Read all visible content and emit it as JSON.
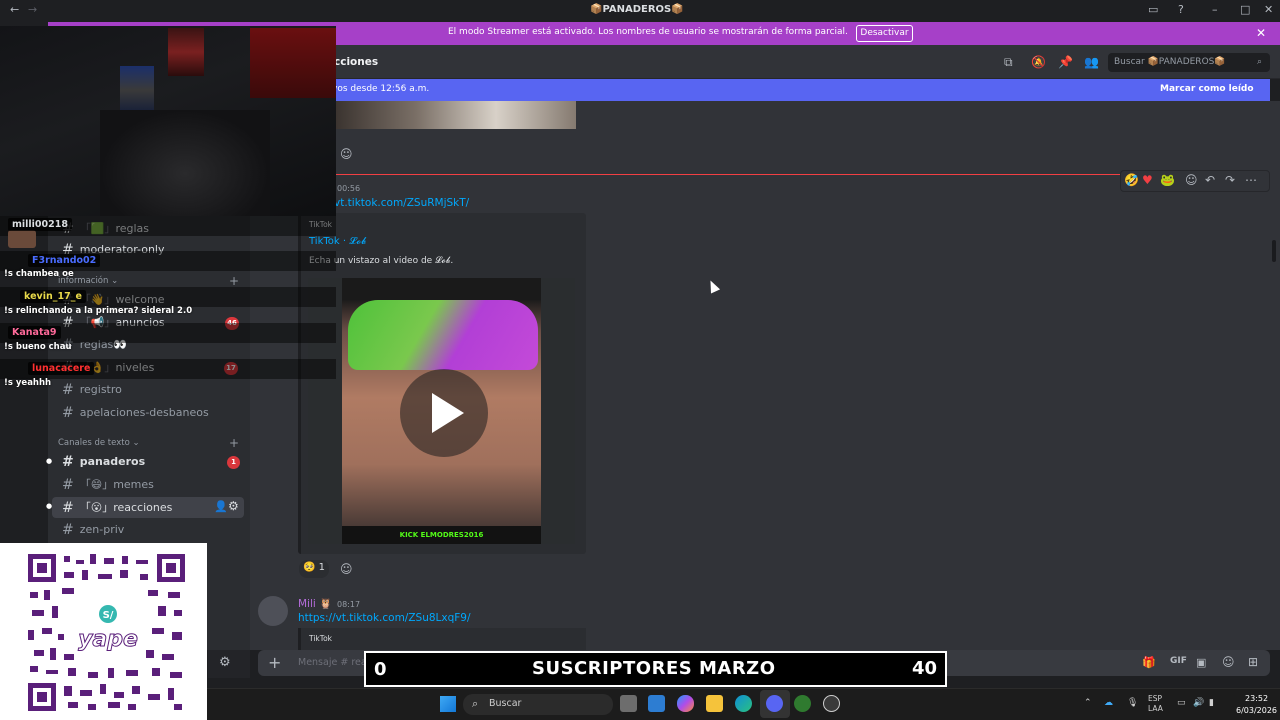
{
  "titlebar": {
    "title": "📦PANADEROS📦"
  },
  "streamer_banner": {
    "text": "El modo Streamer está activado. Los nombres de usuario se mostrarán de forma parcial.",
    "button": "Desactivar"
  },
  "header": {
    "channel": "cciones",
    "search_placeholder": "Buscar 📦PANADEROS📦"
  },
  "new_messages": {
    "text": "vos desde 12:56 a.m.",
    "action": "Marcar como leído"
  },
  "sidebar": {
    "channels_top": [
      {
        "label": "reglas",
        "badge": ""
      },
      {
        "label": "moderator-only",
        "badge": ""
      }
    ],
    "category_info": "información",
    "channels_info": [
      {
        "label": "welcome",
        "badge": ""
      },
      {
        "label": "anuncios",
        "badge": "46"
      },
      {
        "label": "reglas👀",
        "badge": ""
      },
      {
        "label": "niveles",
        "badge": "17"
      },
      {
        "label": "registro",
        "badge": ""
      },
      {
        "label": "apelaciones-desbaneos",
        "badge": ""
      }
    ],
    "category_text": "Canales de texto",
    "channels_text": [
      {
        "label": "panaderos",
        "badge": "1"
      },
      {
        "label": "memes",
        "badge": ""
      },
      {
        "label": "reacciones",
        "badge": ""
      },
      {
        "label": "zen-priv",
        "badge": ""
      }
    ]
  },
  "messages": {
    "first": {
      "time": "00:56",
      "link": "vt.tiktok.com/ZSuRMjSkT/",
      "embed_provider": "TikTok",
      "embed_author": "TikTok · 𝓛𝓸𝓫",
      "embed_desc": "Echa un vistazo al video de 𝓛𝓸𝓫.",
      "video_watermark": "KICK ELMODRES2016",
      "reaction_count": "1"
    },
    "second": {
      "author": "Mili 🦉",
      "time": "08:17",
      "link": "https://vt.tiktok.com/ZSu8LxqF9/",
      "embed_provider": "TikTok"
    }
  },
  "composer": {
    "placeholder": "Mensaje #  reacciones"
  },
  "twitch_chat": [
    {
      "user": "milli00218",
      "color": "#ffffff",
      "message": "!s chambea oe"
    },
    {
      "user": "F3rnando02",
      "color": "#4a6cff",
      "message": "!s relinchando a la primera? sideral 2.0"
    },
    {
      "user": "kevin_17_e",
      "color": "#e8d94a",
      "message": "!s bueno chau"
    },
    {
      "user": "Kanata9",
      "color": "#ff6a9a",
      "message": ""
    },
    {
      "user": "lunacacere",
      "color": "#ff3030",
      "message": "!s yeahhh"
    }
  ],
  "sub_banner": {
    "left": "0",
    "title": "SUSCRIPTORES MARZO",
    "count": "40"
  },
  "taskbar": {
    "search": "Buscar",
    "lang": "ESP\nLAA",
    "time": "23:52",
    "date": "6/03/2026"
  },
  "qr_label": "yape"
}
